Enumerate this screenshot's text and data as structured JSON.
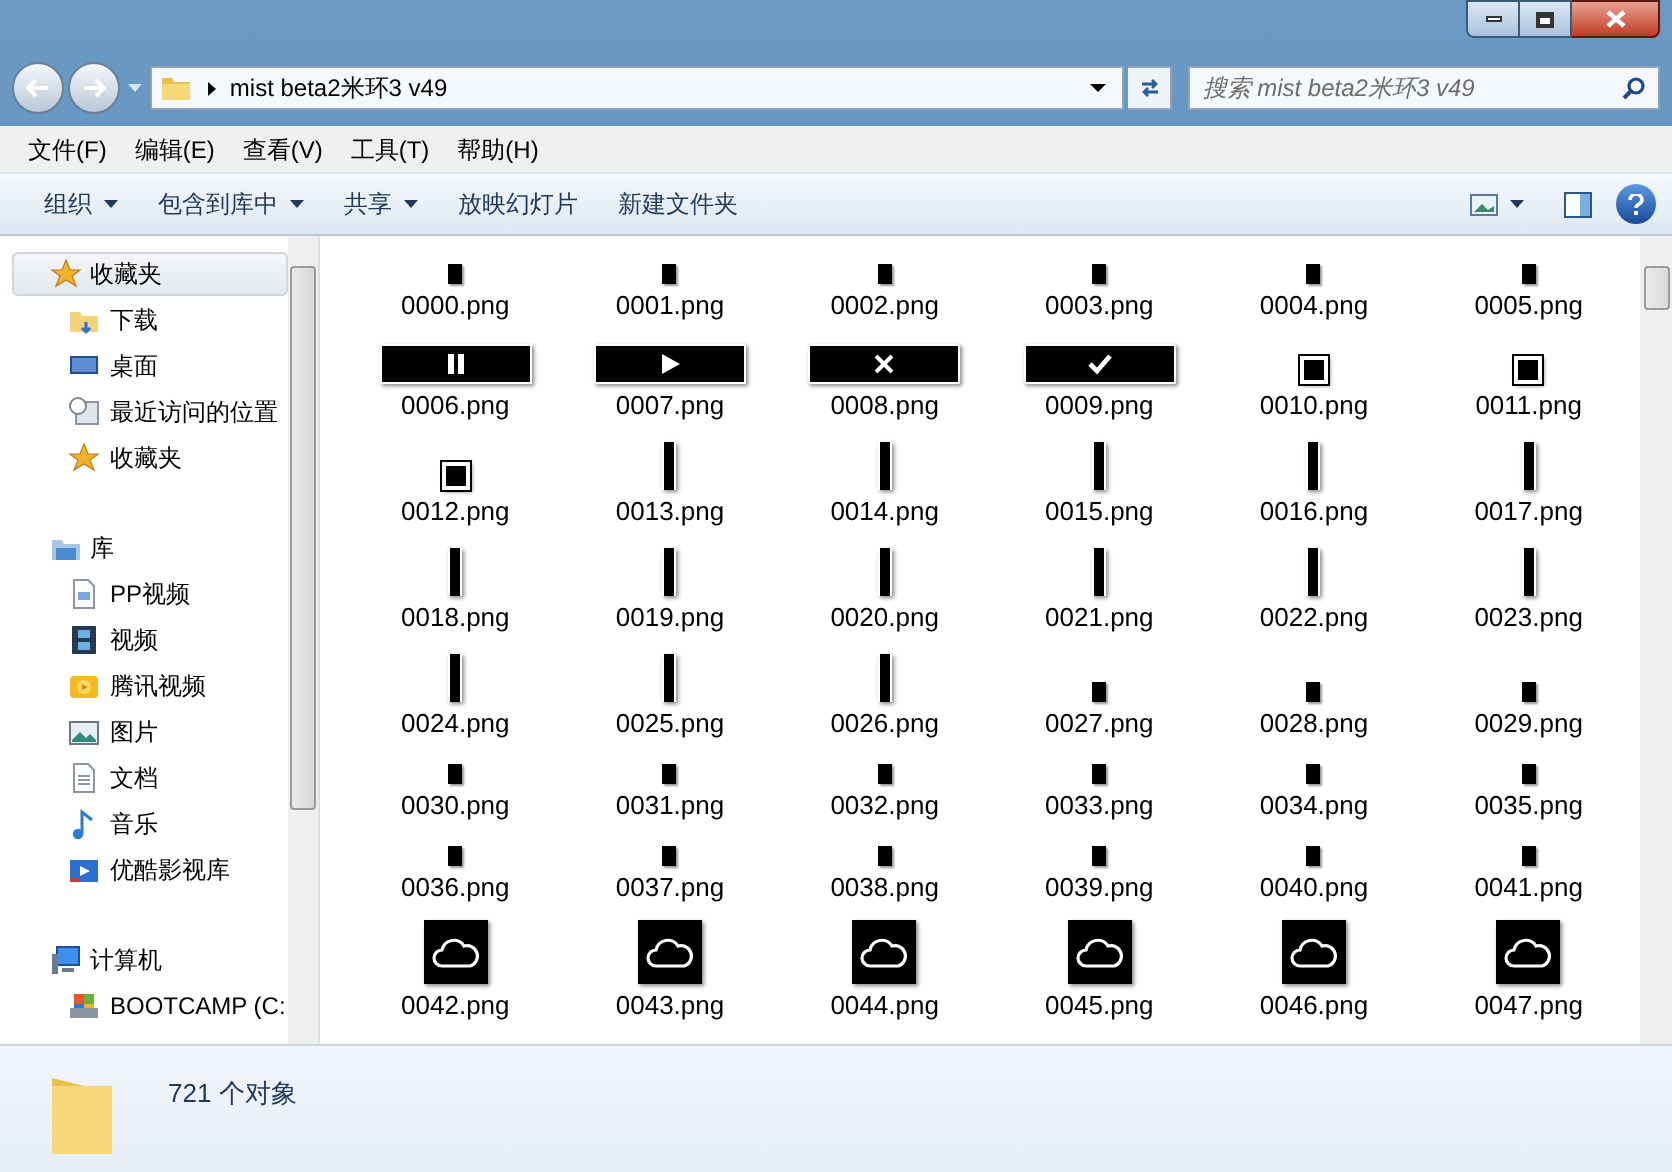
{
  "address": {
    "path": "mist beta2米环3 v49",
    "search_placeholder": "搜索 mist beta2米环3 v49"
  },
  "menu": [
    "文件(F)",
    "编辑(E)",
    "查看(V)",
    "工具(T)",
    "帮助(H)"
  ],
  "toolbar": [
    {
      "label": "组织",
      "dropdown": true
    },
    {
      "label": "包含到库中",
      "dropdown": true
    },
    {
      "label": "共享",
      "dropdown": true
    },
    {
      "label": "放映幻灯片",
      "dropdown": false
    },
    {
      "label": "新建文件夹",
      "dropdown": false
    }
  ],
  "sidebar": {
    "groups": [
      {
        "label": "收藏夹",
        "selected": true,
        "children": [
          {
            "label": "下载",
            "selected": false
          },
          {
            "label": "桌面",
            "selected": false
          },
          {
            "label": "最近访问的位置",
            "selected": false
          },
          {
            "label": "收藏夹",
            "selected": false
          }
        ]
      },
      {
        "label": "库",
        "selected": false,
        "children": [
          {
            "label": "PP视频",
            "selected": false
          },
          {
            "label": "视频",
            "selected": false
          },
          {
            "label": "腾讯视频",
            "selected": false
          },
          {
            "label": "图片",
            "selected": false
          },
          {
            "label": "文档",
            "selected": false
          },
          {
            "label": "音乐",
            "selected": false
          },
          {
            "label": "优酷影视库",
            "selected": false
          }
        ]
      },
      {
        "label": "计算机",
        "selected": false,
        "children": [
          {
            "label": "BOOTCAMP (C:",
            "selected": false
          }
        ]
      }
    ]
  },
  "files": [
    {
      "name": "0000.png",
      "kind": "mark"
    },
    {
      "name": "0001.png",
      "kind": "mark"
    },
    {
      "name": "0002.png",
      "kind": "mark"
    },
    {
      "name": "0003.png",
      "kind": "mark"
    },
    {
      "name": "0004.png",
      "kind": "mark"
    },
    {
      "name": "0005.png",
      "kind": "mark"
    },
    {
      "name": "0006.png",
      "kind": "wide"
    },
    {
      "name": "0007.png",
      "kind": "wide"
    },
    {
      "name": "0008.png",
      "kind": "wide"
    },
    {
      "name": "0009.png",
      "kind": "wide"
    },
    {
      "name": "0010.png",
      "kind": "small"
    },
    {
      "name": "0011.png",
      "kind": "small"
    },
    {
      "name": "0012.png",
      "kind": "small"
    },
    {
      "name": "0013.png",
      "kind": "tall"
    },
    {
      "name": "0014.png",
      "kind": "tall"
    },
    {
      "name": "0015.png",
      "kind": "tall"
    },
    {
      "name": "0016.png",
      "kind": "tall"
    },
    {
      "name": "0017.png",
      "kind": "tall"
    },
    {
      "name": "0018.png",
      "kind": "tall"
    },
    {
      "name": "0019.png",
      "kind": "tall"
    },
    {
      "name": "0020.png",
      "kind": "tall"
    },
    {
      "name": "0021.png",
      "kind": "tall"
    },
    {
      "name": "0022.png",
      "kind": "tall"
    },
    {
      "name": "0023.png",
      "kind": "tall"
    },
    {
      "name": "0024.png",
      "kind": "tall"
    },
    {
      "name": "0025.png",
      "kind": "tall"
    },
    {
      "name": "0026.png",
      "kind": "tall"
    },
    {
      "name": "0027.png",
      "kind": "mark"
    },
    {
      "name": "0028.png",
      "kind": "mark"
    },
    {
      "name": "0029.png",
      "kind": "mark"
    },
    {
      "name": "0030.png",
      "kind": "mark"
    },
    {
      "name": "0031.png",
      "kind": "mark"
    },
    {
      "name": "0032.png",
      "kind": "mark"
    },
    {
      "name": "0033.png",
      "kind": "mark"
    },
    {
      "name": "0034.png",
      "kind": "mark"
    },
    {
      "name": "0035.png",
      "kind": "mark"
    },
    {
      "name": "0036.png",
      "kind": "mark"
    },
    {
      "name": "0037.png",
      "kind": "mark"
    },
    {
      "name": "0038.png",
      "kind": "mark"
    },
    {
      "name": "0039.png",
      "kind": "mark"
    },
    {
      "name": "0040.png",
      "kind": "mark"
    },
    {
      "name": "0041.png",
      "kind": "mark"
    },
    {
      "name": "0042.png",
      "kind": "weather"
    },
    {
      "name": "0043.png",
      "kind": "weather"
    },
    {
      "name": "0044.png",
      "kind": "weather"
    },
    {
      "name": "0045.png",
      "kind": "weather"
    },
    {
      "name": "0046.png",
      "kind": "weather"
    },
    {
      "name": "0047.png",
      "kind": "weather"
    }
  ],
  "status": {
    "count": "721 个对象"
  }
}
